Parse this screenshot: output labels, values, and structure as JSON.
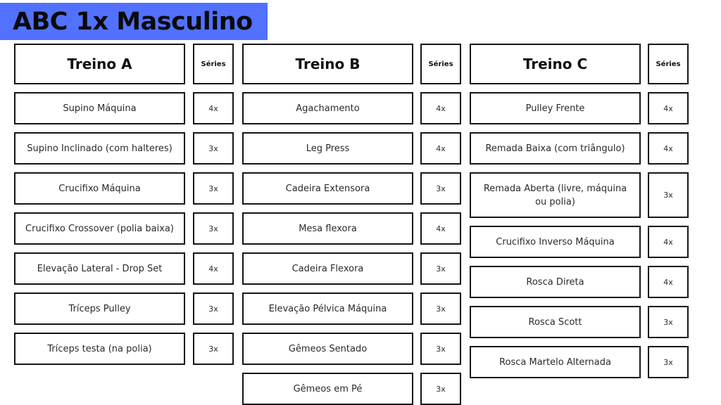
{
  "title": "ABC 1x Masculino",
  "colors": {
    "banner": "#5271ff",
    "border": "#151515"
  },
  "workouts": [
    {
      "title": "Treino A",
      "series_header": "Séries",
      "exercises": [
        {
          "name": "Supino Máquina",
          "sets": "4x"
        },
        {
          "name": "Supino Inclinado (com halteres)",
          "sets": "3x"
        },
        {
          "name": "Crucifixo Máquina",
          "sets": "3x"
        },
        {
          "name": "Crucifixo Crossover (polia baixa)",
          "sets": "3x"
        },
        {
          "name": "Elevação Lateral - Drop Set",
          "sets": "4x"
        },
        {
          "name": "Tríceps Pulley",
          "sets": "3x"
        },
        {
          "name": "Tríceps testa (na polia)",
          "sets": "3x"
        }
      ]
    },
    {
      "title": "Treino B",
      "series_header": "Séries",
      "exercises": [
        {
          "name": "Agachamento",
          "sets": "4x"
        },
        {
          "name": "Leg Press",
          "sets": "4x"
        },
        {
          "name": "Cadeira Extensora",
          "sets": "3x"
        },
        {
          "name": "Mesa flexora",
          "sets": "4x"
        },
        {
          "name": "Cadeira Flexora",
          "sets": "3x"
        },
        {
          "name": "Elevação Pélvica Máquina",
          "sets": "3x"
        },
        {
          "name": "Gêmeos Sentado",
          "sets": "3x"
        },
        {
          "name": "Gêmeos em Pé",
          "sets": "3x"
        }
      ]
    },
    {
      "title": "Treino C",
      "series_header": "Séries",
      "exercises": [
        {
          "name": "Pulley Frente",
          "sets": "4x"
        },
        {
          "name": "Remada Baixa (com triângulo)",
          "sets": "4x"
        },
        {
          "name": "Remada Aberta (livre, máquina ou polia)",
          "sets": "3x"
        },
        {
          "name": "Crucifixo Inverso Máquina",
          "sets": "4x"
        },
        {
          "name": "Rosca Direta",
          "sets": "4x"
        },
        {
          "name": "Rosca Scott",
          "sets": "3x"
        },
        {
          "name": "Rosca Martelo Alternada",
          "sets": "3x"
        }
      ]
    }
  ]
}
